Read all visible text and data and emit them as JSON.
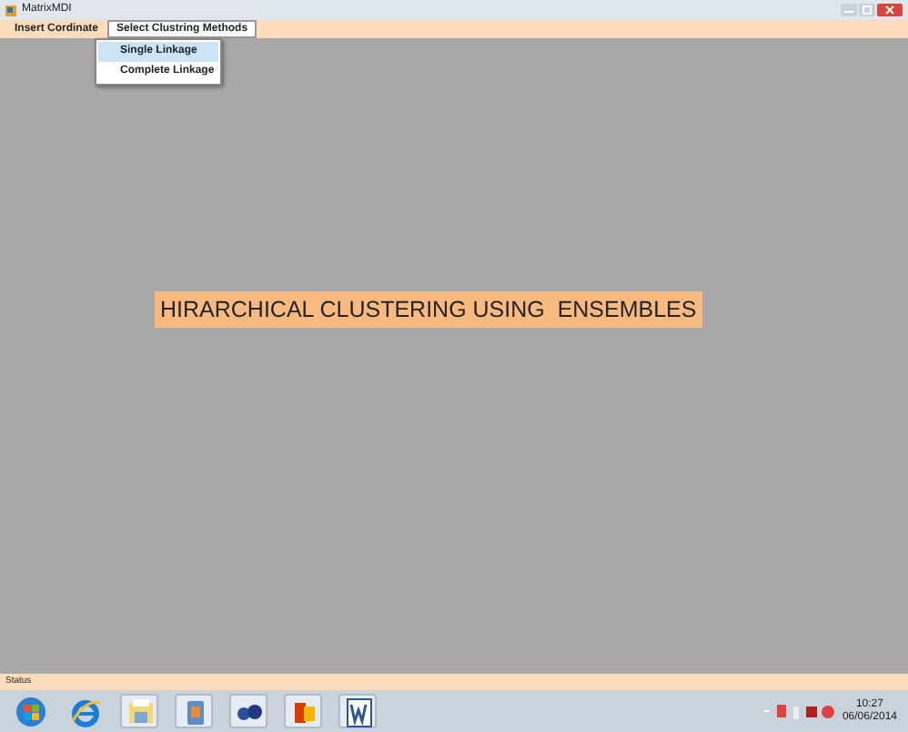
{
  "window": {
    "title": "MatrixMDI"
  },
  "menu": [
    {
      "label": "Insert Cordinate",
      "open": false
    },
    {
      "label": "Select Clustring Methods",
      "open": true
    }
  ],
  "dropdown": [
    {
      "label": "Single Linkage",
      "selected": true
    },
    {
      "label": "Complete Linkage",
      "selected": false
    }
  ],
  "banner": "HIRARCHICAL CLUSTERING USING  ENSEMBLES",
  "status_bar": "Status",
  "taskbar": {
    "apps": [
      {
        "kind": "start"
      },
      {
        "kind": "browser"
      },
      {
        "kind": "folder"
      },
      {
        "kind": "media"
      },
      {
        "kind": "people"
      },
      {
        "kind": "office"
      },
      {
        "kind": "word"
      }
    ],
    "clock": {
      "time": "10:27",
      "date": "06/06/2014"
    }
  }
}
